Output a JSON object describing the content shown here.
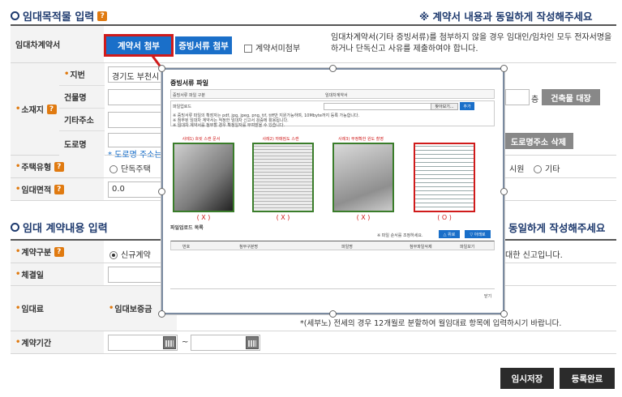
{
  "section1": {
    "title": "임대목적물 입력",
    "help": "?",
    "notice": "※ 계약서 내용과 동일하게 작성해주세요"
  },
  "contract": {
    "label": "임대차계약서",
    "btn_contract": "계약서 첨부",
    "btn_evidence": "증빙서류 첨부",
    "no_attach": "계약서미첨부",
    "desc_line1": "임대차계약서(기타 증빙서류)를 첨부하지 않을 경우 임대인/임차인 모두 전자서명을",
    "desc_line2": "하거나 단독신고 사유를 제출하여야 합니다."
  },
  "location": {
    "label": "소재지",
    "lot_label": "지번",
    "lot_value": "경기도 부천시",
    "building_label": "건물명",
    "floor_suffix": "층",
    "ledger_btn": "건축물 대장",
    "extra_label": "기타주소",
    "road_label": "도로명",
    "road_delete_btn": "도로명주소 삭제",
    "road_note": "* 도로명 주소는"
  },
  "housing": {
    "label": "주택유형",
    "opt1": "단독주택",
    "opt_mid": "시원",
    "opt_other": "기타"
  },
  "area": {
    "label": "임대면적",
    "value": "0.0"
  },
  "section2": {
    "title": "임대 계약내용 입력",
    "notice": "동일하게 작성해주세요"
  },
  "contract_type": {
    "label": "계약구분",
    "opt_new": "신규계약",
    "desc": "대한 신고입니다."
  },
  "sign_date": {
    "label": "체결일"
  },
  "rent": {
    "label": "임대료",
    "deposit_label": "임대보증금",
    "note": "*(세부노) 전세의 경우 12개월로 분할하여 월임대료 항목에 입력하시기 바랍니다."
  },
  "period": {
    "label": "계약기간",
    "tilde": "~"
  },
  "footer": {
    "save_temp": "임시저장",
    "register": "등록완료"
  },
  "popup": {
    "title": "증빙서류 파일",
    "row_type_label": "증빙서류 파일 구분",
    "row_type_value": "임대차계약서",
    "upload_label": "파일업로드",
    "find_btn": "찾아보기...",
    "add_btn": "추가",
    "note1": "※ 증빙서류 파일의 확장자는 pdf, jpg, jpeg, png, tif, tiff만 지원가능하며, 10Mbyte까지 등록 가능합니다.",
    "note2": "※ 첨부된 임대차 계약서는 적정한 임대차 신고서 검증에 활용됩니다.",
    "note3": "※ 임대차 계약서를 첨부할 경우 확정일자를 부여받을 수 있습니다.",
    "examples": [
      {
        "caption": "사례1) 흐릿 스캔 문서",
        "mark": "( X )"
      },
      {
        "caption": "사례2) 까매짐도 스캔",
        "mark": "( X )"
      },
      {
        "caption": "사례3) 부정확한 원도 촬영",
        "mark": "( X )"
      },
      {
        "caption": "",
        "mark": "( O )"
      }
    ],
    "list_title": "파일업로드 목록",
    "order_note": "※ 파일 순서를 조정하세요.",
    "up_btn": "△ 위로",
    "down_btn": "▽ 아래로",
    "cols": [
      "번호",
      "첨부구분명",
      "파일명",
      "첨부파일삭제",
      "파일보기"
    ],
    "close": "닫기"
  },
  "colors": {
    "navy": "#1e3a6e",
    "blue": "#1a6fc9",
    "orange": "#e07a10",
    "red": "#d01b1b",
    "green": "#3a7d2a"
  }
}
